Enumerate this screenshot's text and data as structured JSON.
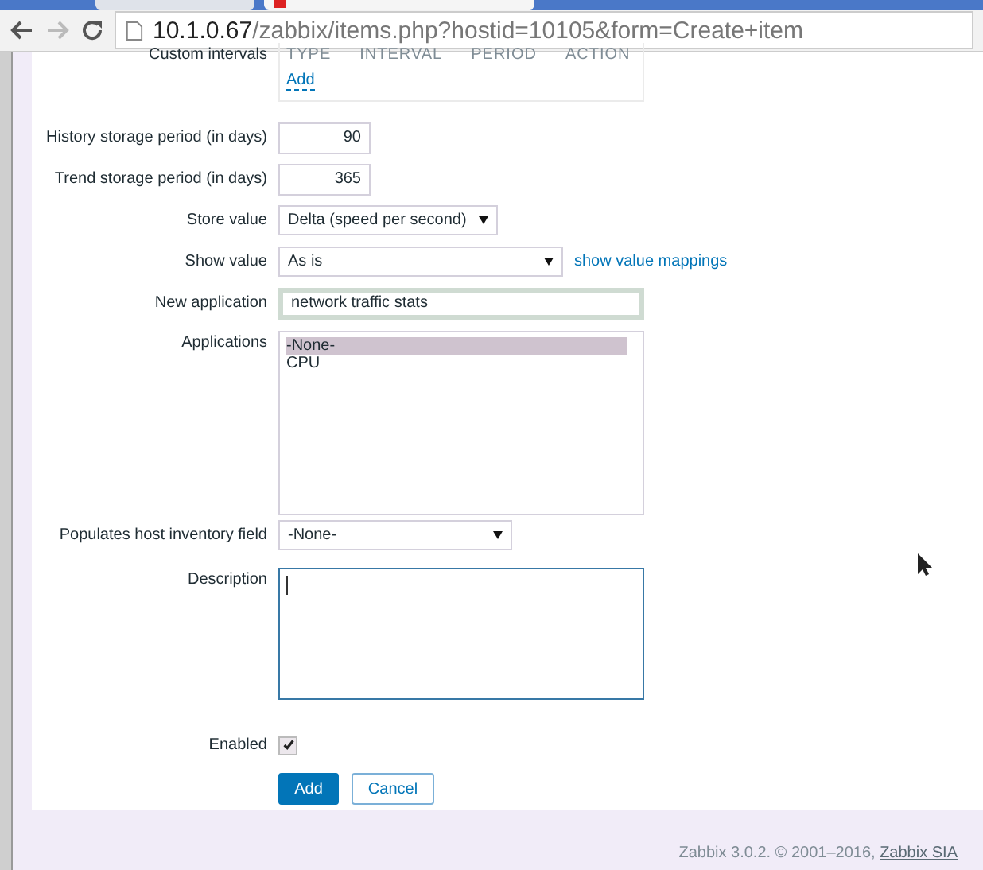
{
  "browser": {
    "url_host": "10.1.0.67",
    "url_path": "/zabbix/items.php?hostid=10105&form=Create+item"
  },
  "custom_intervals": {
    "label": "Custom intervals",
    "columns": [
      "TYPE",
      "INTERVAL",
      "PERIOD",
      "ACTION"
    ],
    "add_link": "Add"
  },
  "fields": [
    {
      "kind": "number",
      "label": "History storage period (in days)",
      "value": "90"
    },
    {
      "kind": "number",
      "label": "Trend storage period (in days)",
      "value": "365"
    },
    {
      "kind": "select",
      "label": "Store value",
      "value": "Delta (speed per second)"
    },
    {
      "kind": "select",
      "label": "Show value",
      "value": "As is",
      "link": "show value mappings"
    },
    {
      "kind": "text",
      "label": "New application",
      "value": "network traffic stats",
      "focused": true
    },
    {
      "kind": "listbox",
      "label": "Applications",
      "options": [
        {
          "label": "-None-",
          "selected": true
        },
        {
          "label": "CPU",
          "selected": false
        }
      ]
    },
    {
      "kind": "select",
      "label": "Populates host inventory field",
      "value": "-None-"
    },
    {
      "kind": "textarea",
      "label": "Description",
      "focused": true
    },
    {
      "kind": "checkbox",
      "label": "Enabled",
      "checked": true
    }
  ],
  "buttons": [
    {
      "label": "Add",
      "primary": true
    },
    {
      "label": "Cancel",
      "primary": false
    }
  ],
  "footer": {
    "text": "Zabbix 3.0.2. © 2001–2016,",
    "link": "Zabbix SIA"
  }
}
